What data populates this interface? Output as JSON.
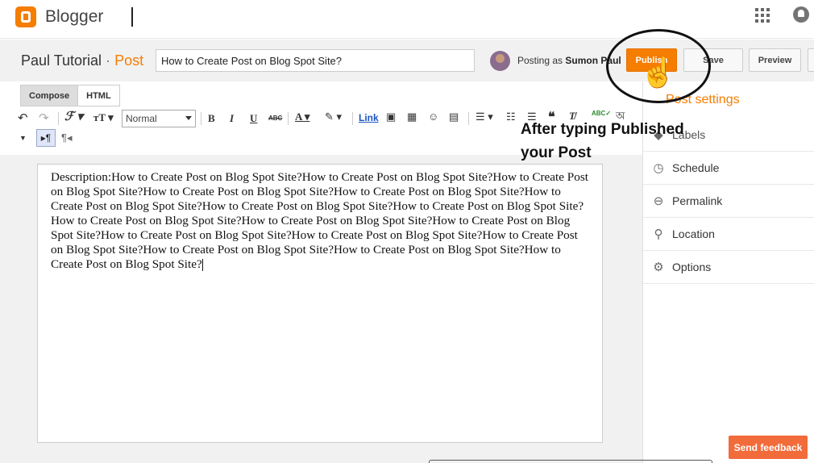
{
  "app": {
    "brand": "Blogger"
  },
  "header": {
    "blog_name": "Paul Tutorial",
    "separator": "·",
    "section": "Post",
    "title_value": "How to Create Post on Blog Spot Site?",
    "posting_as_prefix": "Posting as",
    "author": "Sumon Paul"
  },
  "actions": {
    "publish": "Publish",
    "save": "Save",
    "preview": "Preview"
  },
  "annotation": {
    "line1": "After typing Published",
    "line2": "your Post"
  },
  "editor": {
    "tabs": [
      "Compose",
      "HTML"
    ],
    "font_size_value": "Normal",
    "link_label": "Link",
    "content": "Description:How to Create Post on Blog Spot Site?How to Create Post on Blog Spot Site?How to Create Post on Blog Spot Site?How to Create Post on Blog Spot Site?How to Create Post on Blog Spot Site?How to Create Post on Blog Spot Site?How to Create Post on Blog Spot Site?How to Create Post on Blog Spot Site?How to Create Post on Blog Spot Site?How to Create Post on Blog Spot Site?How to Create Post on Blog Spot Site?How to Create Post on Blog Spot Site?How to Create Post on Blog Spot Site?How to Create Post on Blog Spot Site?How to Create Post on Blog Spot Site?How to Create Post on Blog Spot Site?How to Create Post on Blog Spot Site?"
  },
  "sidebar": {
    "title": "Post settings",
    "items": [
      {
        "label": "Labels",
        "icon": "tag-icon"
      },
      {
        "label": "Schedule",
        "icon": "clock-icon"
      },
      {
        "label": "Permalink",
        "icon": "link-icon"
      },
      {
        "label": "Location",
        "icon": "pin-icon"
      },
      {
        "label": "Options",
        "icon": "gear-icon"
      }
    ]
  },
  "feedback": "Send feedback",
  "colors": {
    "accent": "#f57d00",
    "feedback": "#f26b3a"
  }
}
